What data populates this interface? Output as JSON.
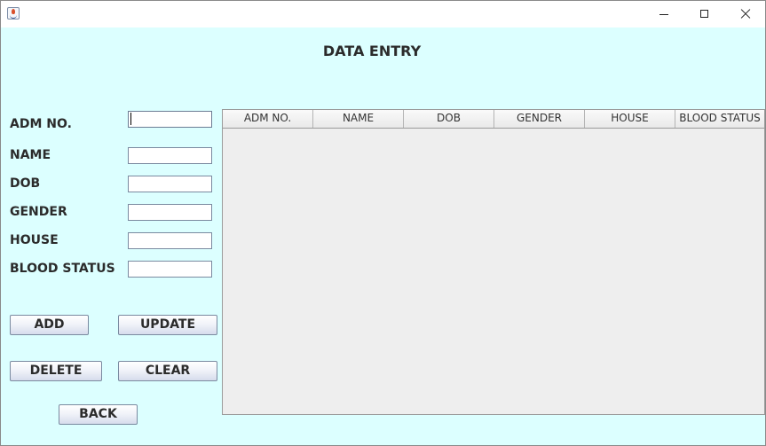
{
  "window": {
    "title": "",
    "controls": {
      "minimize": "minimize",
      "maximize": "maximize",
      "close": "close"
    }
  },
  "heading": "DATA ENTRY",
  "form": {
    "fields": [
      {
        "label": "ADM NO.",
        "value": ""
      },
      {
        "label": "NAME",
        "value": ""
      },
      {
        "label": "DOB",
        "value": ""
      },
      {
        "label": "GENDER",
        "value": ""
      },
      {
        "label": "HOUSE",
        "value": ""
      },
      {
        "label": "BLOOD STATUS",
        "value": ""
      }
    ]
  },
  "buttons": {
    "add": "ADD",
    "update": "UPDATE",
    "delete": "DELETE",
    "clear": "CLEAR",
    "back": "BACK"
  },
  "table": {
    "columns": [
      "ADM NO.",
      "NAME",
      "DOB",
      "GENDER",
      "HOUSE",
      "BLOOD STATUS"
    ],
    "rows": []
  },
  "colors": {
    "background": "#dcffff",
    "table_background": "#eeeeee",
    "text": "#2b2b2b"
  },
  "icons": {
    "app": "java-cup-icon",
    "minimize": "minimize-icon",
    "maximize": "maximize-icon",
    "close": "close-icon"
  }
}
